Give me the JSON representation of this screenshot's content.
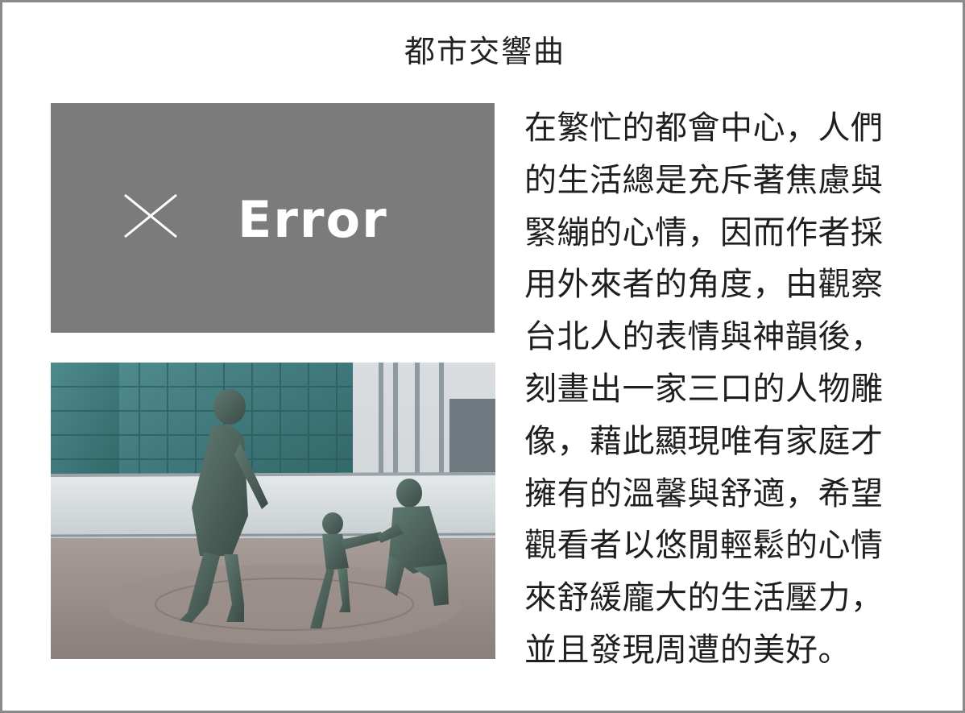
{
  "title": "都市交響曲",
  "error_panel": {
    "icon": "close-icon",
    "label": "Error",
    "background": "#7b7b7b"
  },
  "photo": {
    "subject": "sculpture-family-statue"
  },
  "description": "在繁忙的都會中心，人們的生活總是充斥著焦慮與緊繃的心情，因而作者採用外來者的角度，由觀察台北人的表情與神韻後，刻畫出一家三口的人物雕像，藉此顯現唯有家庭才擁有的溫馨與舒適，希望觀看者以悠閒輕鬆的心情來舒緩龐大的生活壓力，並且發現周遭的美好。"
}
